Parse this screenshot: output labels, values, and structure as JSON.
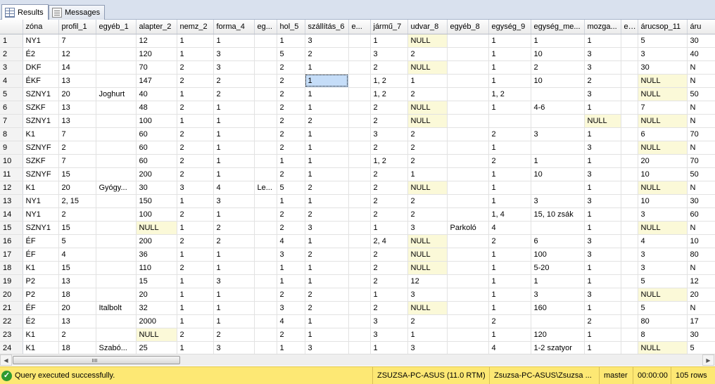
{
  "tabs": [
    {
      "label": "Results",
      "icon": "grid-icon",
      "active": true
    },
    {
      "label": "Messages",
      "icon": "messages-icon",
      "active": false
    }
  ],
  "columns": [
    "",
    "zóna",
    "profil_1",
    "egyéb_1",
    "alapter_2",
    "nemz_2",
    "forma_4",
    "eg...",
    "hol_5",
    "szállítás_6",
    "e...",
    "jármű_7",
    "udvar_8",
    "egyéb_8",
    "egység_9",
    "egység_me...",
    "mozga...",
    "e...",
    "árucsop_11",
    "áru"
  ],
  "rows": [
    [
      "1",
      "NY1",
      "7",
      "",
      "12",
      "1",
      "1",
      "",
      "1",
      "3",
      "",
      "1",
      "NULL",
      "",
      "1",
      "1",
      "1",
      "",
      "5",
      "30"
    ],
    [
      "2",
      "É2",
      "12",
      "",
      "120",
      "1",
      "3",
      "",
      "5",
      "2",
      "",
      "3",
      "2",
      "",
      "1",
      "10",
      "3",
      "",
      "3",
      "40"
    ],
    [
      "3",
      "DKF",
      "14",
      "",
      "70",
      "2",
      "3",
      "",
      "2",
      "1",
      "",
      "2",
      "NULL",
      "",
      "1",
      "2",
      "3",
      "",
      "30",
      "N"
    ],
    [
      "4",
      "ÉKF",
      "13",
      "",
      "147",
      "2",
      "2",
      "",
      "2",
      "1",
      "",
      "1, 2",
      "1",
      "",
      "1",
      "10",
      "2",
      "",
      "NULL",
      "N"
    ],
    [
      "5",
      "SZNY1",
      "20",
      "Joghurt",
      "40",
      "1",
      "2",
      "",
      "2",
      "1",
      "",
      "1, 2",
      "2",
      "",
      "1, 2",
      "",
      "3",
      "",
      "NULL",
      "50"
    ],
    [
      "6",
      "SZKF",
      "13",
      "",
      "48",
      "2",
      "1",
      "",
      "2",
      "1",
      "",
      "2",
      "NULL",
      "",
      "1",
      "4-6",
      "1",
      "",
      "7",
      "N"
    ],
    [
      "7",
      "SZNY1",
      "13",
      "",
      "100",
      "1",
      "1",
      "",
      "2",
      "2",
      "",
      "2",
      "NULL",
      "",
      "",
      "",
      "NULL",
      "",
      "NULL",
      "N"
    ],
    [
      "8",
      "K1",
      "7",
      "",
      "60",
      "2",
      "1",
      "",
      "2",
      "1",
      "",
      "3",
      "2",
      "",
      "2",
      "3",
      "1",
      "",
      "6",
      "70"
    ],
    [
      "9",
      "SZNYF",
      "2",
      "",
      "60",
      "2",
      "1",
      "",
      "2",
      "1",
      "",
      "2",
      "2",
      "",
      "1",
      "",
      "3",
      "",
      "NULL",
      "N"
    ],
    [
      "10",
      "SZKF",
      "7",
      "",
      "60",
      "2",
      "1",
      "",
      "1",
      "1",
      "",
      "1, 2",
      "2",
      "",
      "2",
      "1",
      "1",
      "",
      "20",
      "70"
    ],
    [
      "11",
      "SZNYF",
      "15",
      "",
      "200",
      "2",
      "1",
      "",
      "2",
      "1",
      "",
      "2",
      "1",
      "",
      "1",
      "10",
      "3",
      "",
      "10",
      "50"
    ],
    [
      "12",
      "K1",
      "20",
      "Gyógy...",
      "30",
      "3",
      "4",
      "Le...",
      "5",
      "2",
      "",
      "2",
      "NULL",
      "",
      "1",
      "",
      "1",
      "",
      "NULL",
      "N"
    ],
    [
      "13",
      "NY1",
      "2, 15",
      "",
      "150",
      "1",
      "3",
      "",
      "1",
      "1",
      "",
      "2",
      "2",
      "",
      "1",
      "3",
      "3",
      "",
      "10",
      "30"
    ],
    [
      "14",
      "NY1",
      "2",
      "",
      "100",
      "2",
      "1",
      "",
      "2",
      "2",
      "",
      "2",
      "2",
      "",
      "1, 4",
      "15, 10 zsák",
      "1",
      "",
      "3",
      "60"
    ],
    [
      "15",
      "SZNY1",
      "15",
      "",
      "NULL",
      "1",
      "2",
      "",
      "2",
      "3",
      "",
      "1",
      "3",
      "Parkoló",
      "4",
      "",
      "1",
      "",
      "NULL",
      "N"
    ],
    [
      "16",
      "ÉF",
      "5",
      "",
      "200",
      "2",
      "2",
      "",
      "4",
      "1",
      "",
      "2, 4",
      "NULL",
      "",
      "2",
      "6",
      "3",
      "",
      "4",
      "10"
    ],
    [
      "17",
      "ÉF",
      "4",
      "",
      "36",
      "1",
      "1",
      "",
      "3",
      "2",
      "",
      "2",
      "NULL",
      "",
      "1",
      "100",
      "3",
      "",
      "3",
      "80"
    ],
    [
      "18",
      "K1",
      "15",
      "",
      "110",
      "2",
      "1",
      "",
      "1",
      "1",
      "",
      "2",
      "NULL",
      "",
      "1",
      "5-20",
      "1",
      "",
      "3",
      "N"
    ],
    [
      "19",
      "P2",
      "13",
      "",
      "15",
      "1",
      "3",
      "",
      "1",
      "1",
      "",
      "2",
      "12",
      "",
      "1",
      "1",
      "1",
      "",
      "5",
      "12"
    ],
    [
      "20",
      "P2",
      "18",
      "",
      "20",
      "1",
      "1",
      "",
      "2",
      "2",
      "",
      "1",
      "3",
      "",
      "1",
      "3",
      "3",
      "",
      "NULL",
      "20"
    ],
    [
      "21",
      "ÉF",
      "20",
      "Italbolt",
      "32",
      "1",
      "1",
      "",
      "3",
      "2",
      "",
      "2",
      "NULL",
      "",
      "1",
      "160",
      "1",
      "",
      "5",
      "N"
    ],
    [
      "22",
      "É2",
      "13",
      "",
      "2000",
      "1",
      "1",
      "",
      "4",
      "1",
      "",
      "3",
      "2",
      "",
      "2",
      "",
      "2",
      "",
      "80",
      "17"
    ],
    [
      "23",
      "K1",
      "2",
      "",
      "NULL",
      "2",
      "2",
      "",
      "2",
      "1",
      "",
      "3",
      "1",
      "",
      "1",
      "120",
      "1",
      "",
      "8",
      "30"
    ],
    [
      "24",
      "K1",
      "18",
      "Szabó...",
      "25",
      "1",
      "3",
      "",
      "1",
      "3",
      "",
      "1",
      "3",
      "",
      "4",
      "1-2 szatyor",
      "1",
      "",
      "NULL",
      "5"
    ]
  ],
  "selected_cell": {
    "row": 4,
    "col": 9
  },
  "status": {
    "message": "Query executed successfully.",
    "server": "ZSUZSA-PC-ASUS (11.0 RTM)",
    "user": "Zsuzsa-PC-ASUS\\Zsuzsa ...",
    "database": "master",
    "elapsed": "00:00:00",
    "rows": "105 rows"
  },
  "colors": {
    "null_cell": "#fbf9d8",
    "status_bar": "#fde874",
    "selection": "#c5ddf8"
  }
}
